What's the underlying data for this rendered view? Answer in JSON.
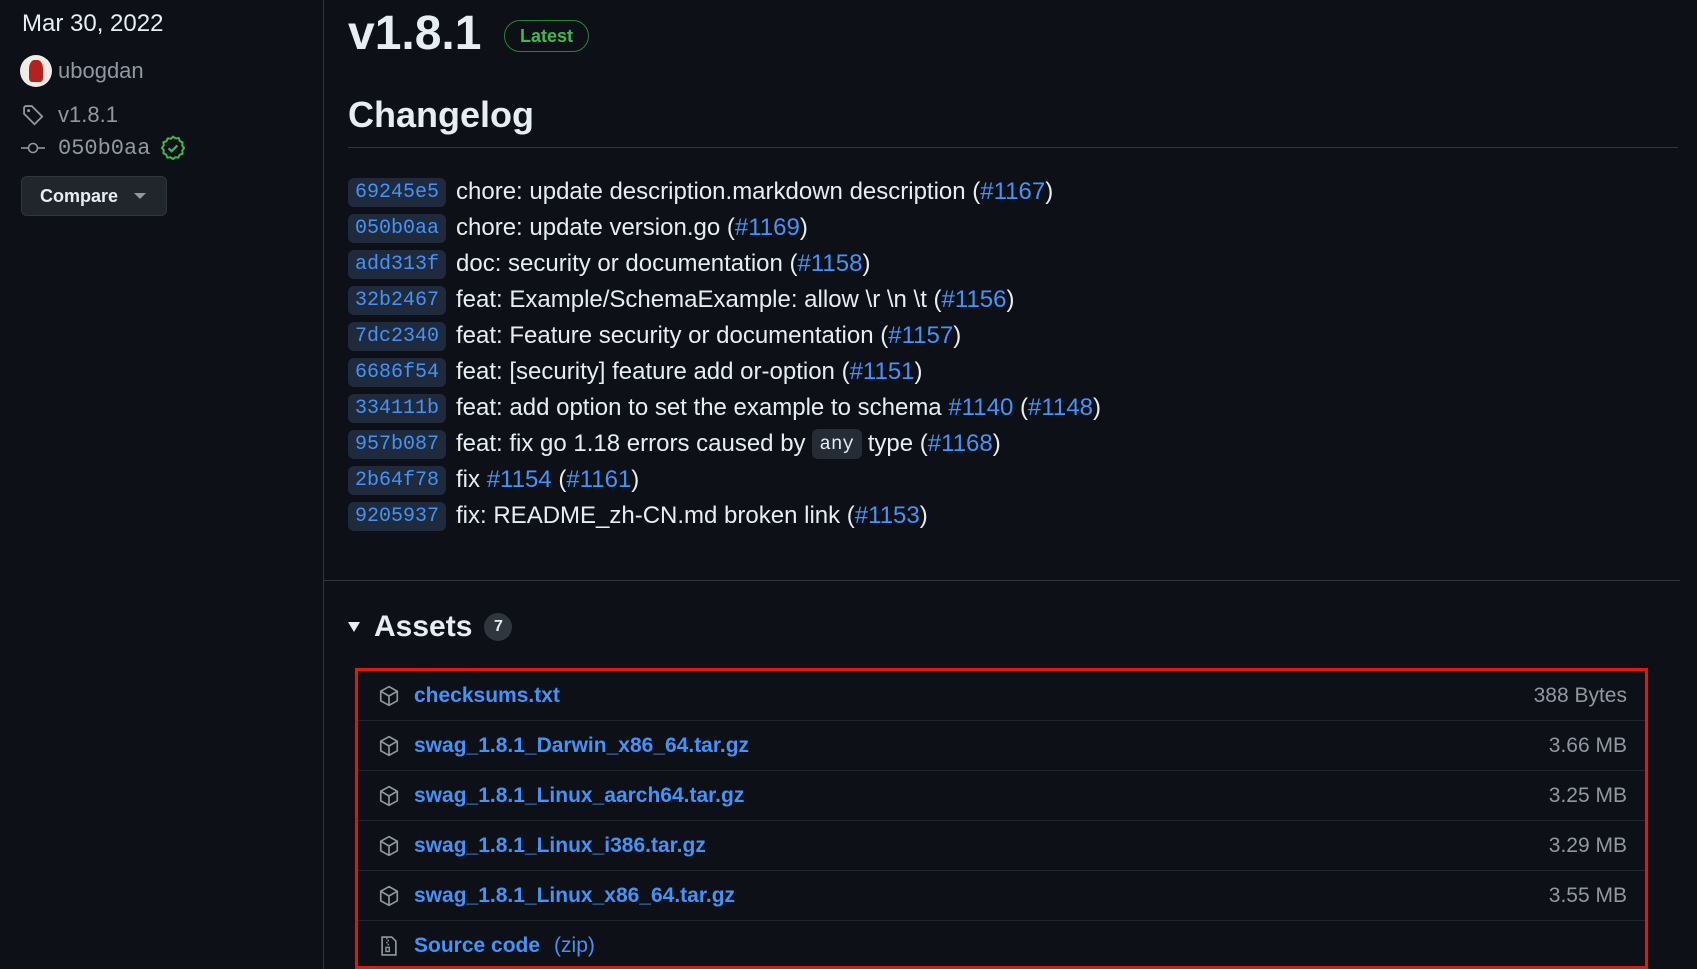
{
  "sidebar": {
    "date": "Mar 30, 2022",
    "author": "ubogdan",
    "tag": "v1.8.1",
    "commit": "050b0aa",
    "compare_label": "Compare"
  },
  "release": {
    "version": "v1.8.1",
    "badge": "Latest"
  },
  "changelog": {
    "title": "Changelog",
    "commits": [
      {
        "sha": "69245e5",
        "message": "chore: update description.markdown description (",
        "pr": "#1167",
        "close": ")"
      },
      {
        "sha": "050b0aa",
        "message": "chore: update version.go (",
        "pr": "#1169",
        "close": ")"
      },
      {
        "sha": "add313f",
        "message": "doc: security or documentation (",
        "pr": "#1158",
        "close": ")"
      },
      {
        "sha": "32b2467",
        "message": "feat: Example/SchemaExample: allow \\r \\n \\t (",
        "pr": "#1156",
        "close": ")"
      },
      {
        "sha": "7dc2340",
        "message": "feat: Feature security or documentation (",
        "pr": "#1157",
        "close": ")"
      },
      {
        "sha": "6686f54",
        "message": "feat: [security] feature add or-option (",
        "pr": "#1151",
        "close": ")"
      },
      {
        "sha": "334111b",
        "message": "feat: add option to set the example to schema ",
        "pr": "#1140",
        "mid": " (",
        "pr2": "#1148",
        "close": ")"
      },
      {
        "sha": "957b087",
        "message": "feat: fix go 1.18 errors caused by",
        "code": "any",
        "message2": "type (",
        "pr": "#1168",
        "close": ")"
      },
      {
        "sha": "2b64f78",
        "message": "fix ",
        "pr": "#1154",
        "mid": " (",
        "pr2": "#1161",
        "close": ")"
      },
      {
        "sha": "9205937",
        "message": "fix: README_zh-CN.md broken link (",
        "pr": "#1153",
        "close": ")"
      }
    ]
  },
  "assets": {
    "title": "Assets",
    "count": "7",
    "items": [
      {
        "name": "checksums.txt",
        "size": "388 Bytes",
        "icon": "package-icon"
      },
      {
        "name": "swag_1.8.1_Darwin_x86_64.tar.gz",
        "size": "3.66 MB",
        "icon": "package-icon"
      },
      {
        "name": "swag_1.8.1_Linux_aarch64.tar.gz",
        "size": "3.25 MB",
        "icon": "package-icon"
      },
      {
        "name": "swag_1.8.1_Linux_i386.tar.gz",
        "size": "3.29 MB",
        "icon": "package-icon"
      },
      {
        "name": "swag_1.8.1_Linux_x86_64.tar.gz",
        "size": "3.55 MB",
        "icon": "package-icon"
      },
      {
        "name": "Source code",
        "suffix": "(zip)",
        "size": "",
        "icon": "file-zip-icon"
      }
    ]
  },
  "colors": {
    "background": "#0d1117",
    "link": "#4493f8",
    "latest_badge": "#3fb950",
    "highlight_box": "#e0180e"
  }
}
